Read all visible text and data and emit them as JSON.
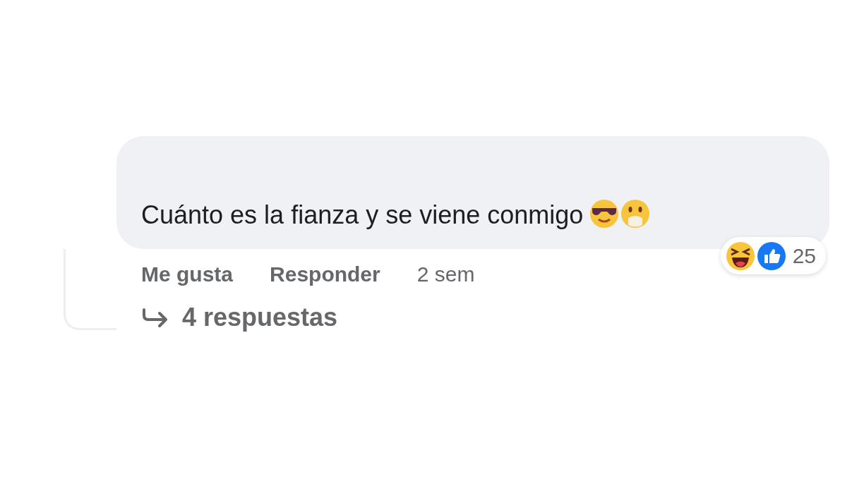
{
  "comment": {
    "text": "Cuánto es la fianza y se viene conmigo"
  },
  "reactions": {
    "count": "25"
  },
  "actions": [
    {
      "label": "Me gusta"
    },
    {
      "label": "Responder"
    }
  ],
  "time": "2 sem",
  "replies": {
    "label": "4 respuestas"
  }
}
